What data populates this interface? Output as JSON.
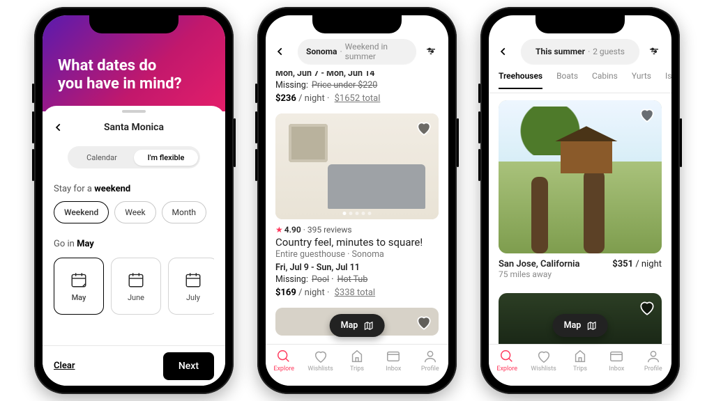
{
  "phone1": {
    "hero_line1": "What dates do",
    "hero_line2": "you have in mind?",
    "location": "Santa Monica",
    "seg_calendar": "Calendar",
    "seg_flexible": "I'm flexible",
    "stay_prefix": "Stay for a ",
    "stay_value": "weekend",
    "durations": [
      "Weekend",
      "Week",
      "Month"
    ],
    "go_prefix": "Go in ",
    "go_value": "May",
    "months": [
      "May",
      "June",
      "July"
    ],
    "clear": "Clear",
    "next": "Next"
  },
  "phone2": {
    "search_main": "Sonoma",
    "search_sub": "Weekend in summer",
    "peek": {
      "dates": "Mon, Jun 7 - Mon, Jun 14",
      "missing_label": "Missing:",
      "missing_value": "Price under $220",
      "price": "$236",
      "per": "/ night",
      "total": "$1652 total"
    },
    "listing": {
      "rating": "4.90",
      "reviews": "395 reviews",
      "title": "Country feel, minutes to square!",
      "type": "Entire guesthouse · Sonoma",
      "dates": "Fri, Jul 9 - Sun, Jul 11",
      "missing_label": "Missing:",
      "missing_value1": "Pool",
      "missing_value2": "Hot Tub",
      "price": "$169",
      "per": "/ night",
      "total": "$338 total"
    },
    "map_label": "Map",
    "tabs": [
      "Explore",
      "Wishlists",
      "Trips",
      "Inbox",
      "Profile"
    ]
  },
  "phone3": {
    "search_main": "This summer",
    "search_sub": "2 guests",
    "categories": [
      "Treehouses",
      "Boats",
      "Cabins",
      "Yurts",
      "Islands"
    ],
    "listing": {
      "location": "San Jose, California",
      "distance": "75 miles away",
      "price": "$351",
      "per": "/ night"
    },
    "map_label": "Map",
    "tabs": [
      "Explore",
      "Wishlists",
      "Trips",
      "Inbox",
      "Profile"
    ]
  }
}
